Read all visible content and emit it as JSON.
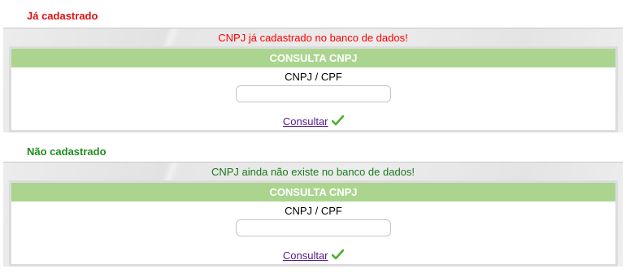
{
  "sections": [
    {
      "title": "Já cadastrado",
      "message": "CNPJ já cadastrado no banco de dados!",
      "form": {
        "header": "CONSULTA CNPJ",
        "field_label": "CNPJ / CPF",
        "field_value": "",
        "field_placeholder": "",
        "submit_label": "Consultar",
        "submit_icon": "check-icon"
      }
    },
    {
      "title": "Não cadastrado",
      "message": "CNPJ ainda não existe no banco de dados!",
      "form": {
        "header": "CONSULTA CNPJ",
        "field_label": "CNPJ / CPF",
        "field_value": "",
        "field_placeholder": "",
        "submit_label": "Consultar",
        "submit_icon": "check-icon"
      }
    }
  ],
  "colors": {
    "error_title": "#e01010",
    "error_message": "#ff0000",
    "success_title": "#228b22",
    "success_message": "#1a7a1a",
    "form_header_bg": "#abd58f",
    "link": "#551a8b",
    "check_icon": "#4caf2a"
  }
}
